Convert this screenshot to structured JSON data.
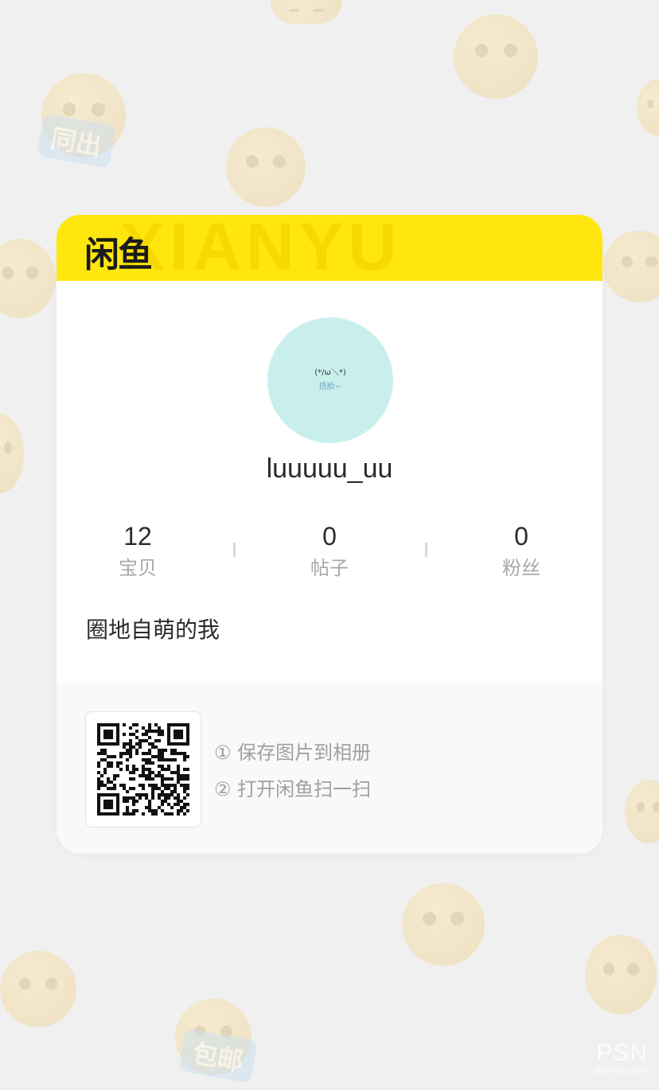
{
  "header": {
    "logo_text": "闲鱼",
    "watermark_text": "XIANYU",
    "brand_color": "#ffe60f"
  },
  "profile": {
    "avatar_face": "(*/ω＼*)",
    "avatar_caption": "捂脸~",
    "username": "luuuuu_uu",
    "bio": "圈地自萌的我"
  },
  "stats": [
    {
      "value": "12",
      "label": "宝贝"
    },
    {
      "value": "0",
      "label": "帖子"
    },
    {
      "value": "0",
      "label": "粉丝"
    }
  ],
  "footer": {
    "qr_icon": "qr-code",
    "instructions": [
      "① 保存图片到相册",
      "② 打开闲鱼扫一扫"
    ]
  },
  "background": {
    "tags": [
      "同出",
      "包邮"
    ]
  },
  "watermark": {
    "logo": "PSN",
    "sub": "psnine.com"
  }
}
